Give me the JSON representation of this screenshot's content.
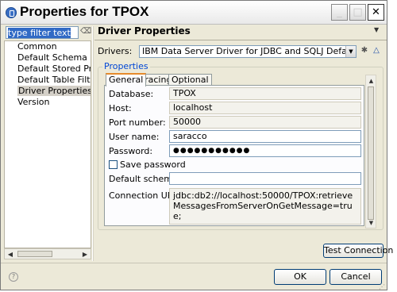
{
  "window": {
    "title": "Properties for TPOX",
    "minimize_glyph": "_",
    "maximize_glyph": "□",
    "close_glyph": "✕"
  },
  "filter": {
    "value": "type filter text"
  },
  "nav": {
    "items": [
      {
        "label": "Common"
      },
      {
        "label": "Default Schema Filter"
      },
      {
        "label": "Default Stored Proce"
      },
      {
        "label": "Default Table Filter"
      },
      {
        "label": "Driver Properties"
      },
      {
        "label": "Version"
      }
    ],
    "selected_label": "Driver Properties"
  },
  "page": {
    "title": "Driver Properties"
  },
  "drivers": {
    "label": "Drivers:",
    "value": "IBM Data Server Driver for JDBC and SQLJ Default"
  },
  "properties": {
    "group_title": "Properties",
    "tabs": [
      {
        "label": "General"
      },
      {
        "label": "Tracing"
      },
      {
        "label": "Optional"
      }
    ],
    "active_tab": "General",
    "fields": {
      "database": {
        "label": "Database:",
        "value": "TPOX"
      },
      "host": {
        "label": "Host:",
        "value": "localhost"
      },
      "port": {
        "label": "Port number:",
        "value": "50000"
      },
      "user": {
        "label": "User name:",
        "value": "saracco"
      },
      "password": {
        "label": "Password:",
        "value": "●●●●●●●●●●●"
      },
      "save_password": {
        "label": "Save password",
        "checked": false
      },
      "default_schema": {
        "label": "Default schema:",
        "value": ""
      },
      "connection_url": {
        "label": "Connection URL:",
        "value": "jdbc:db2://localhost:50000/TPOX:retrieveMessagesFromServerOnGetMessage=true;"
      }
    }
  },
  "buttons": {
    "test_connection": "Test Connection",
    "ok": "OK",
    "cancel": "Cancel"
  },
  "colors": {
    "accent": "#0046d5",
    "active_tab_highlight": "#e68b2c",
    "dialog_background": "#ece9d8"
  }
}
